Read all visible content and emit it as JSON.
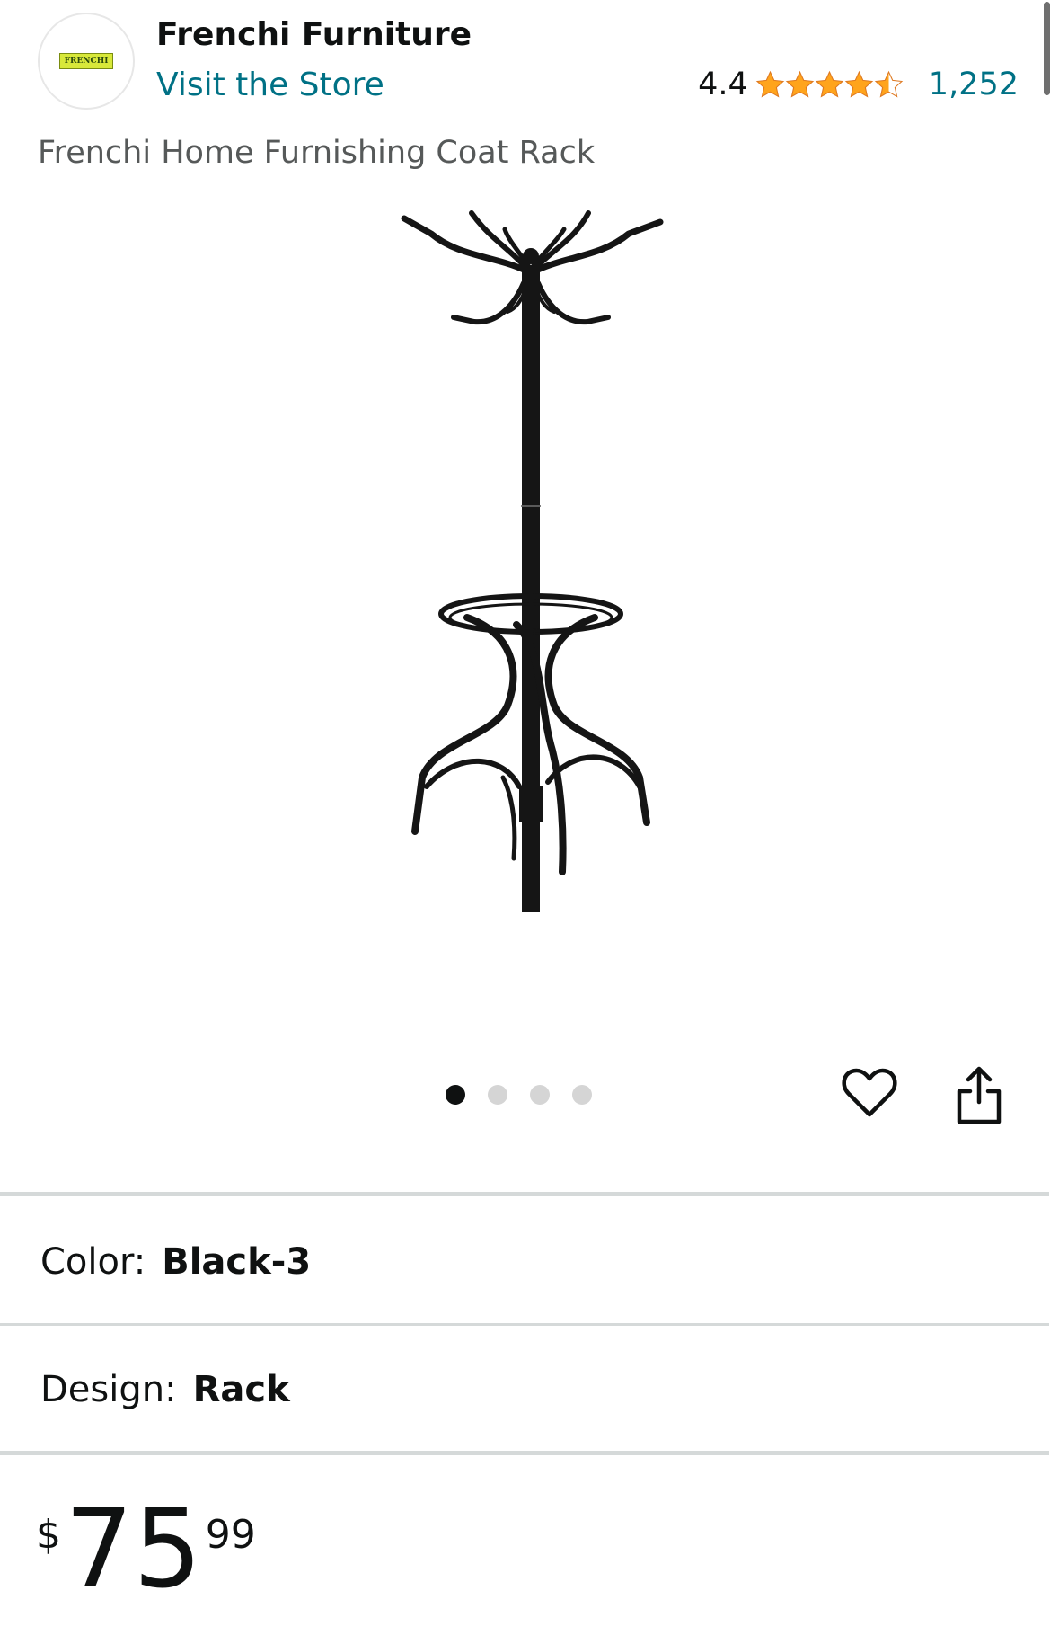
{
  "store": {
    "logo_text": "FRENCHI",
    "name": "Frenchi Furniture",
    "visit_label": "Visit the Store"
  },
  "rating": {
    "value": "4.4",
    "stars_filled": 4.4,
    "review_count": "1,252",
    "star_color": "#ffa41c"
  },
  "product": {
    "title": "Frenchi Home Furnishing Coat Rack",
    "image_icon": "coat-rack-image"
  },
  "carousel": {
    "total_images": 4,
    "active_index": 0
  },
  "actions": {
    "wishlist_icon": "heart-icon",
    "share_icon": "share-icon"
  },
  "options": {
    "color_label": "Color:",
    "color_value": "Black-3",
    "design_label": "Design:",
    "design_value": "Rack"
  },
  "price": {
    "symbol": "$",
    "whole": "75",
    "fraction": "99"
  },
  "colors": {
    "link": "#007185",
    "text": "#0f1111",
    "muted": "#565959",
    "star": "#ffa41c"
  }
}
